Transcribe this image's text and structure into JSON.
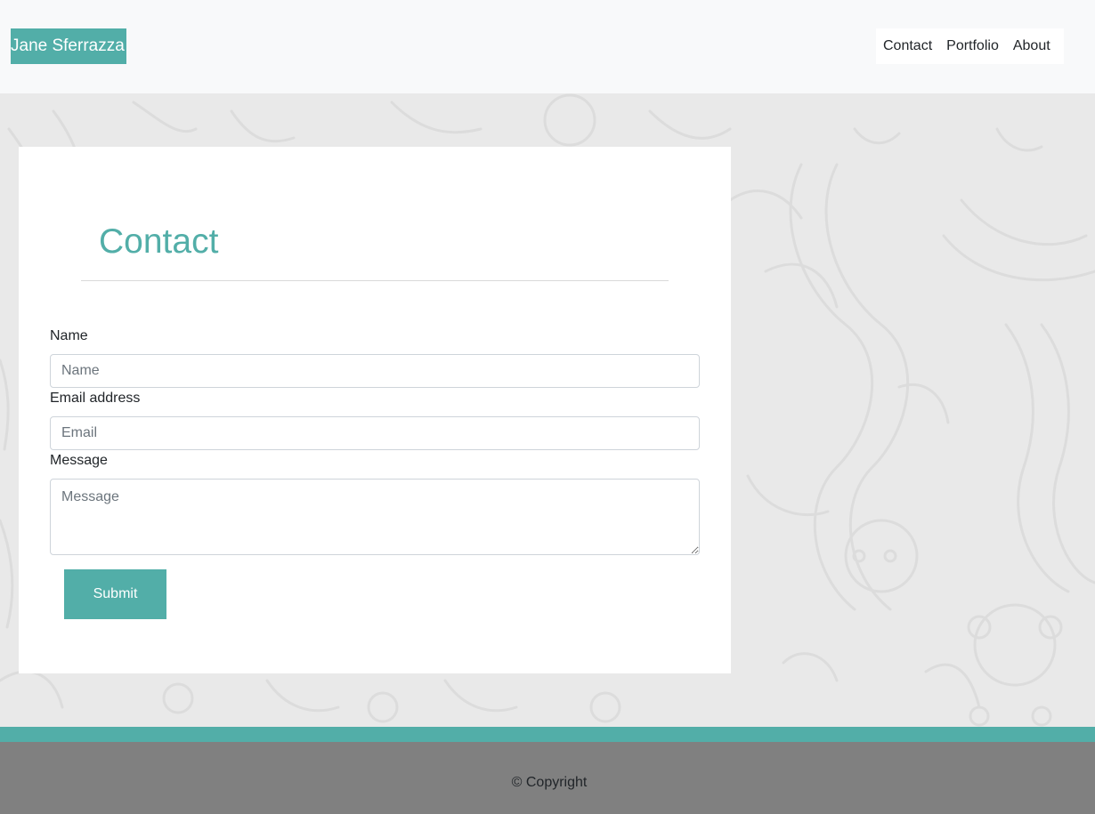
{
  "header": {
    "brand": "Jane Sferrazza",
    "nav": [
      "Contact",
      "Portfolio",
      "About"
    ]
  },
  "contact": {
    "title": "Contact",
    "fields": {
      "name_label": "Name",
      "name_placeholder": "Name",
      "email_label": "Email address",
      "email_placeholder": "Email",
      "message_label": "Message",
      "message_placeholder": "Message"
    },
    "submit_label": "Submit"
  },
  "footer": {
    "copyright": "© Copyright"
  },
  "colors": {
    "accent": "#52aea8",
    "header_bg": "#f8f9fa",
    "page_bg": "#e9e9e9",
    "footer_bg": "#808080"
  }
}
